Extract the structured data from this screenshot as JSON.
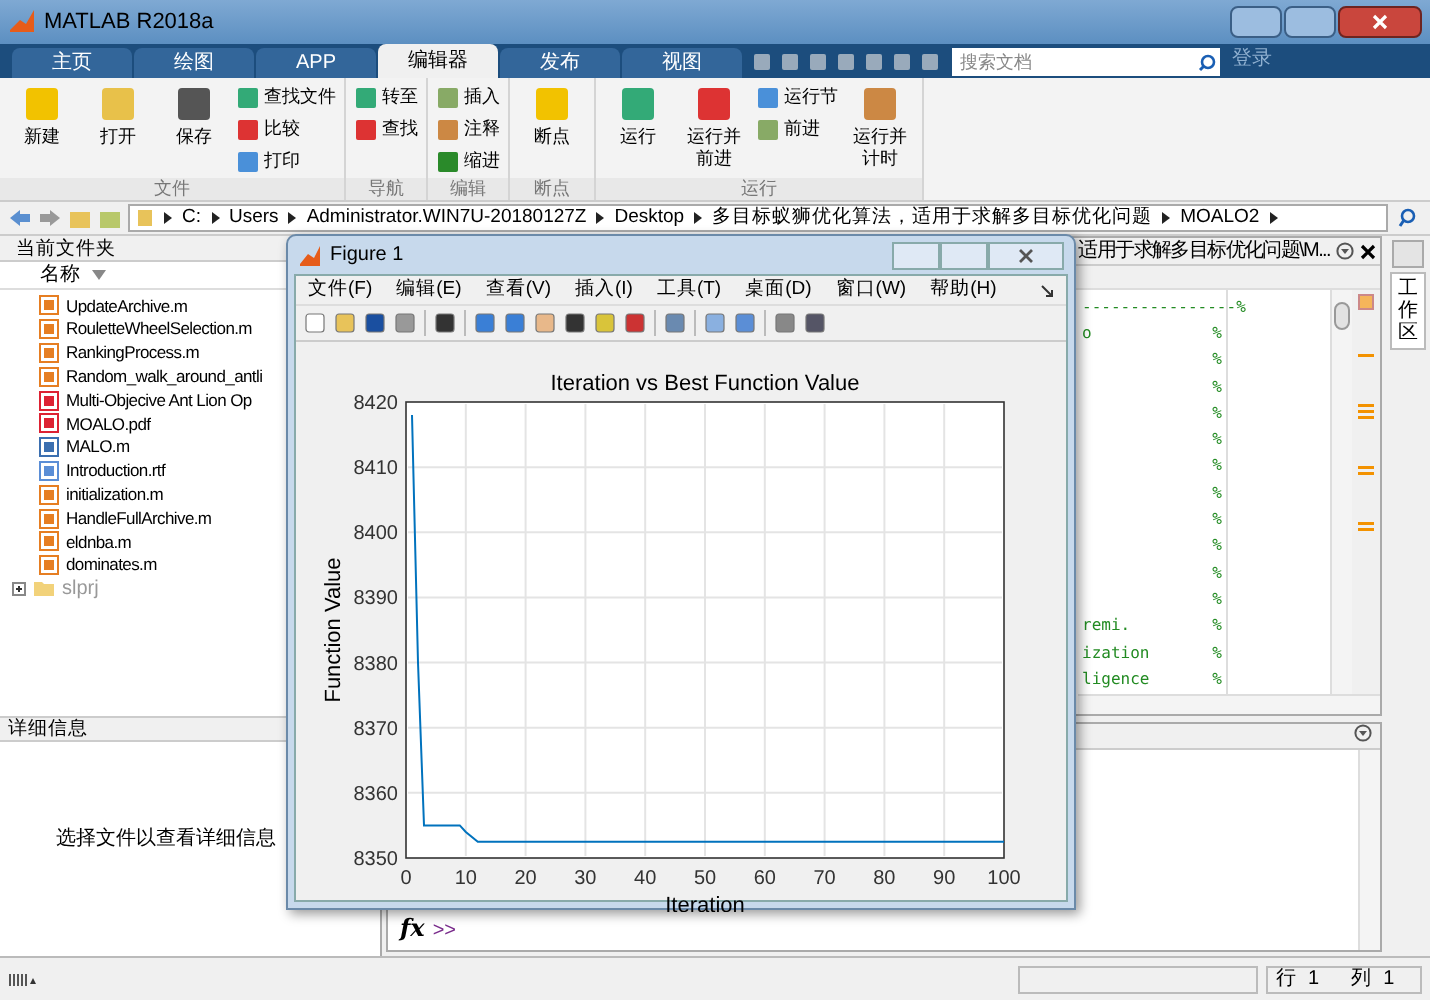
{
  "window": {
    "title": "MATLAB R2018a"
  },
  "tabs": [
    {
      "label": "主页",
      "selected": false
    },
    {
      "label": "绘图",
      "selected": false
    },
    {
      "label": "APP",
      "selected": false
    },
    {
      "label": "编辑器",
      "selected": true
    },
    {
      "label": "发布",
      "selected": false
    },
    {
      "label": "视图",
      "selected": false
    }
  ],
  "search": {
    "placeholder": "搜索文档"
  },
  "login": "登录",
  "ribbon": {
    "groups": [
      {
        "label": "文件",
        "buttons": [
          {
            "label": "新建",
            "kind": "large"
          },
          {
            "label": "打开",
            "kind": "large"
          },
          {
            "label": "保存",
            "kind": "large"
          },
          {
            "label": "查找文件",
            "kind": "small"
          },
          {
            "label": "比较",
            "kind": "small"
          },
          {
            "label": "打印",
            "kind": "small"
          }
        ]
      },
      {
        "label": "导航",
        "buttons": [
          {
            "label": "转至",
            "kind": "small"
          },
          {
            "label": "查找",
            "kind": "small"
          }
        ]
      },
      {
        "label": "编辑",
        "buttons": [
          {
            "label": "插入",
            "kind": "small"
          },
          {
            "label": "注释",
            "kind": "small"
          },
          {
            "label": "缩进",
            "kind": "small"
          }
        ]
      },
      {
        "label": "断点",
        "buttons": [
          {
            "label": "断点",
            "kind": "large"
          }
        ]
      },
      {
        "label": "运行",
        "buttons": [
          {
            "label": "运行",
            "kind": "large"
          },
          {
            "label": "运行并前进",
            "kind": "large"
          },
          {
            "label": "运行节",
            "kind": "small"
          },
          {
            "label": "前进",
            "kind": "small"
          },
          {
            "label": "运行并计时",
            "kind": "large"
          }
        ]
      }
    ]
  },
  "address": {
    "segments": [
      "C:",
      "Users",
      "Administrator.WIN7U-20180127Z",
      "Desktop",
      "多目标蚁狮优化算法，适用于求解多目标优化问题",
      "MOALO2"
    ]
  },
  "current_folder": {
    "title": "当前文件夹",
    "column": "名称",
    "items": [
      {
        "name": "UpdateArchive.m",
        "kind": "m"
      },
      {
        "name": "RouletteWheelSelection.m",
        "kind": "m"
      },
      {
        "name": "RankingProcess.m",
        "kind": "m"
      },
      {
        "name": "Random_walk_around_antli",
        "kind": "m"
      },
      {
        "name": "Multi-Objecive Ant Lion Op",
        "kind": "pdf"
      },
      {
        "name": "MOALO.pdf",
        "kind": "pdf"
      },
      {
        "name": "MALO.m",
        "kind": "script"
      },
      {
        "name": "Introduction.rtf",
        "kind": "rtf"
      },
      {
        "name": "initialization.m",
        "kind": "m"
      },
      {
        "name": "HandleFullArchive.m",
        "kind": "m"
      },
      {
        "name": "eldnba.m",
        "kind": "m"
      },
      {
        "name": "dominates.m",
        "kind": "m"
      },
      {
        "name": "slprj",
        "kind": "folder",
        "expanded": false
      }
    ]
  },
  "details": {
    "title": "详细信息",
    "message": "选择文件以查看详细信息"
  },
  "editor": {
    "tab_title": "适用于求解多目标优化问题\\M...",
    "lines": [
      {
        "text": "----------------",
        "mark": "%"
      },
      {
        "text": "o",
        "mark": "%"
      },
      {
        "mark": "%"
      },
      {
        "mark": "%"
      },
      {
        "mark": "%"
      },
      {
        "mark": "%"
      },
      {
        "mark": "%"
      },
      {
        "mark": "%"
      },
      {
        "mark": "%"
      },
      {
        "mark": "%"
      },
      {
        "mark": "%"
      },
      {
        "mark": "%"
      },
      {
        "text": "remi.",
        "mark": "%"
      },
      {
        "text": "ization",
        "mark": "%"
      },
      {
        "text": "ligence",
        "mark": "%"
      }
    ]
  },
  "workspace_tab": "工作区",
  "command_window": {
    "function_button": "fx",
    "prompt": ">>"
  },
  "status_bar": {
    "row_label": "行",
    "row": "1",
    "col_label": "列",
    "col": "1"
  },
  "figure": {
    "title": "Figure 1",
    "menu": [
      "文件(F)",
      "编辑(E)",
      "查看(V)",
      "插入(I)",
      "工具(T)",
      "桌面(D)",
      "窗口(W)",
      "帮助(H)"
    ],
    "chart_data": {
      "type": "line",
      "title": "Iteration vs Best Function Value",
      "xlabel": "Iteration",
      "ylabel": "Function Value",
      "xlim": [
        0,
        100
      ],
      "ylim": [
        8350,
        8420
      ],
      "xticks": [
        0,
        10,
        20,
        30,
        40,
        50,
        60,
        70,
        80,
        90,
        100
      ],
      "yticks": [
        8350,
        8360,
        8370,
        8380,
        8390,
        8400,
        8410,
        8420
      ],
      "grid": true,
      "series": [
        {
          "color": "#0072bd",
          "x": [
            1,
            2,
            3,
            9,
            10,
            12,
            100
          ],
          "values": [
            8418,
            8380,
            8355,
            8355,
            8354,
            8352.5,
            8352.5
          ]
        }
      ]
    }
  }
}
